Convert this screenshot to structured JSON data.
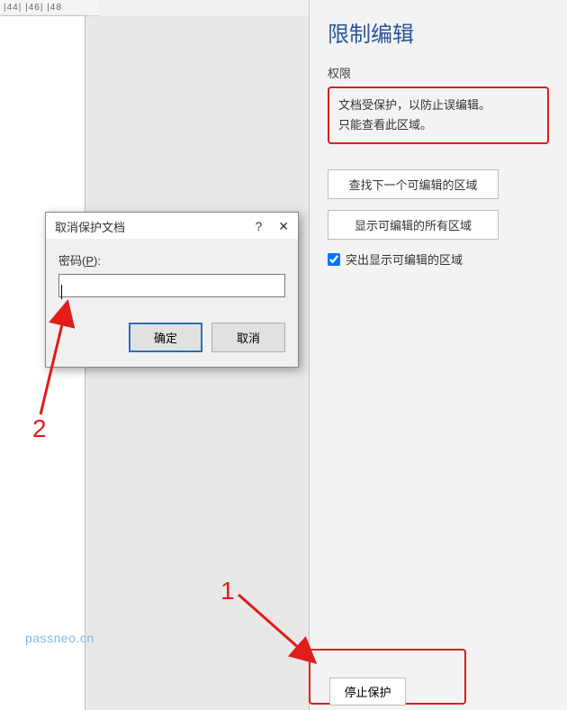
{
  "ruler": {
    "marks": "|44|  |46|  |48"
  },
  "sidebar": {
    "title": "限制编辑",
    "section_label": "权限",
    "info_line1": "文档受保护，以防止误编辑。",
    "info_line2": "只能查看此区域。",
    "btn_find_next": "查找下一个可编辑的区域",
    "btn_show_all": "显示可编辑的所有区域",
    "chk_highlight_label": "突出显示可编辑的区域",
    "chk_highlight_checked": true,
    "stop_protect_label": "停止保护"
  },
  "dialog": {
    "title": "取消保护文档",
    "help_icon": "?",
    "close_icon": "✕",
    "password_label_prefix": "密码(",
    "password_label_key": "P",
    "password_label_suffix": "):",
    "password_value": "",
    "ok_label": "确定",
    "cancel_label": "取消"
  },
  "annotations": {
    "label1": "1",
    "label2": "2"
  },
  "watermark": "passneo.cn"
}
